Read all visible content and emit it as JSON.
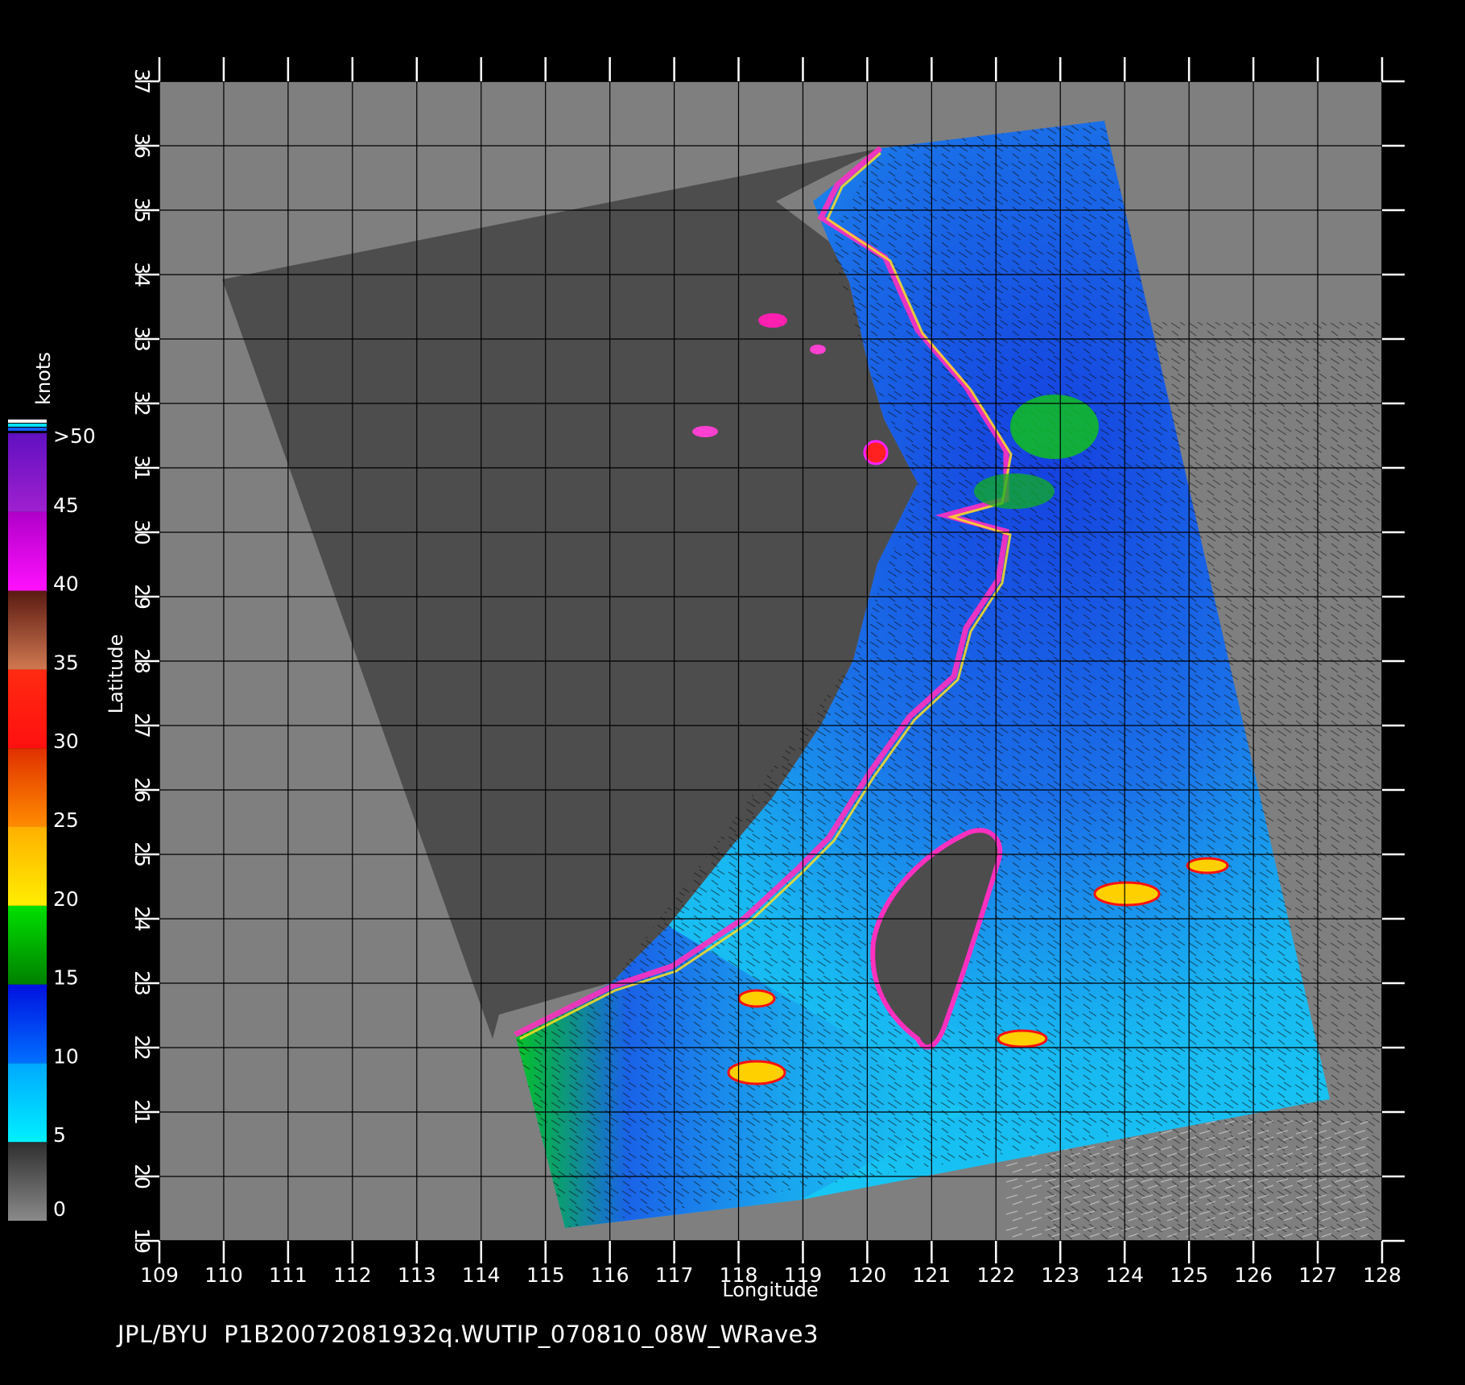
{
  "figure": {
    "footer_source": "JPL/BYU",
    "footer_file": "P1B20072081932q.WUTIP_070810_08W_WRave3"
  },
  "axes": {
    "x_label": "Longitude",
    "y_label": "Latitude",
    "x_ticks": [
      "109",
      "110",
      "111",
      "112",
      "113",
      "114",
      "115",
      "116",
      "117",
      "118",
      "119",
      "120",
      "121",
      "122",
      "123",
      "124",
      "125",
      "126",
      "127",
      "128"
    ],
    "y_ticks": [
      "19",
      "20",
      "21",
      "22",
      "23",
      "24",
      "25",
      "26",
      "27",
      "28",
      "29",
      "30",
      "31",
      "32",
      "33",
      "34",
      "35",
      "36",
      "37"
    ],
    "x_range": [
      109,
      128
    ],
    "y_range": [
      19,
      37
    ]
  },
  "colorbar": {
    "unit": "knots",
    "labels": [
      "0",
      "5",
      "10",
      "15",
      "20",
      "25",
      "30",
      "35",
      "40",
      "45",
      ">50"
    ],
    "bands": [
      {
        "from": 0,
        "to": 5,
        "colors": [
          "#8a8a8a",
          "#2e2e2e"
        ]
      },
      {
        "from": 5,
        "to": 10,
        "colors": [
          "#00f0ff",
          "#00a8ff"
        ]
      },
      {
        "from": 10,
        "to": 15,
        "colors": [
          "#0070ff",
          "#0010e0"
        ]
      },
      {
        "from": 15,
        "to": 20,
        "colors": [
          "#008000",
          "#00e000"
        ]
      },
      {
        "from": 20,
        "to": 25,
        "colors": [
          "#ffee00",
          "#ffb000"
        ]
      },
      {
        "from": 25,
        "to": 30,
        "colors": [
          "#ff8c00",
          "#e03000"
        ]
      },
      {
        "from": 30,
        "to": 35,
        "colors": [
          "#ff1010",
          "#ff2a10"
        ]
      },
      {
        "from": 35,
        "to": 40,
        "colors": [
          "#d07850",
          "#5a1a12"
        ]
      },
      {
        "from": 40,
        "to": 45,
        "colors": [
          "#ff10ff",
          "#b000c8"
        ]
      },
      {
        "from": 45,
        "to": 50,
        "colors": [
          "#a020d0",
          "#6010c0"
        ]
      }
    ]
  },
  "colors": {
    "background_frame": "#000000",
    "map_background": "#7f7f7f",
    "no_data_swath": "#4d4d4d",
    "grid": "#000000",
    "ocean_low": "#19c8f0",
    "ocean_mid": "#1a6ee6",
    "coast_fringe_high": "#ff30c0"
  },
  "chart_data": {
    "type": "heatmap",
    "title": "",
    "xlabel": "Longitude",
    "ylabel": "Latitude",
    "xlim": [
      109,
      128
    ],
    "ylim": [
      19,
      37
    ],
    "colorbar_unit": "knots",
    "colorbar_range": [
      0,
      50
    ],
    "swath_corners_lonlat": [
      [
        110.0,
        33.9
      ],
      [
        120.0,
        35.9
      ],
      [
        123.7,
        36.4
      ],
      [
        127.3,
        21.2
      ],
      [
        115.4,
        19.2
      ],
      [
        114.2,
        22.2
      ]
    ],
    "grid": true
  }
}
